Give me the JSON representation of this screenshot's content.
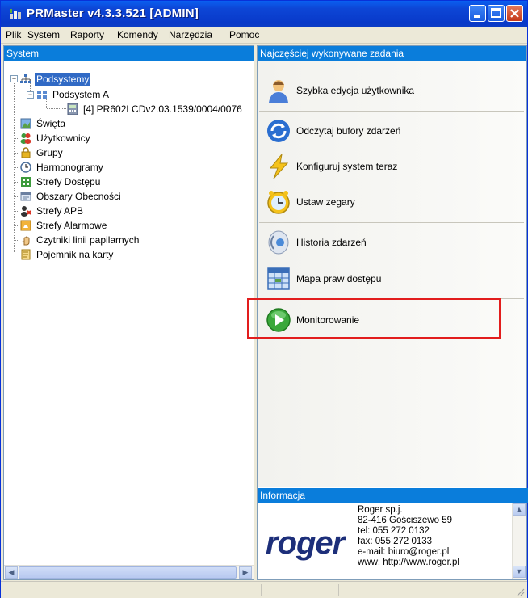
{
  "window": {
    "title": "PRMaster v4.3.3.521 [ADMIN]"
  },
  "menu": [
    "Plik",
    "System",
    "Raporty",
    "Komendy",
    "Narzędzia",
    "Pomoc"
  ],
  "left_panel": {
    "header": "System",
    "tree": [
      {
        "label": "Podsystemy",
        "icon": "network-icon",
        "selected": true
      },
      {
        "label": "Podsystem A",
        "icon": "subsystem-icon"
      },
      {
        "label": "[4] PR602LCDv2.03.1539/0004/0076",
        "icon": "device-icon"
      },
      {
        "label": "Święta",
        "icon": "holiday-icon"
      },
      {
        "label": "Użytkownicy",
        "icon": "users-icon"
      },
      {
        "label": "Grupy",
        "icon": "groups-icon"
      },
      {
        "label": "Harmonogramy",
        "icon": "schedule-icon"
      },
      {
        "label": "Strefy Dostępu",
        "icon": "access-zone-icon"
      },
      {
        "label": "Obszary Obecności",
        "icon": "attendance-area-icon"
      },
      {
        "label": "Strefy APB",
        "icon": "apb-zone-icon"
      },
      {
        "label": "Strefy Alarmowe",
        "icon": "alarm-zone-icon"
      },
      {
        "label": "Czytniki linii papilarnych",
        "icon": "fingerprint-icon"
      },
      {
        "label": "Pojemnik na karty",
        "icon": "card-container-icon"
      }
    ]
  },
  "right_panel": {
    "header": "Najczęściej wykonywane zadania",
    "tasks": [
      {
        "label": "Szybka edycja użytkownika",
        "icon": "user-edit-icon"
      },
      {
        "label": "Odczytaj bufory zdarzeń",
        "icon": "read-buffer-icon"
      },
      {
        "label": "Konfiguruj system teraz",
        "icon": "configure-icon"
      },
      {
        "label": "Ustaw zegary",
        "icon": "clock-icon"
      },
      {
        "label": "Historia zdarzeń",
        "icon": "history-icon"
      },
      {
        "label": "Mapa praw dostępu",
        "icon": "access-map-icon"
      },
      {
        "label": "Monitorowanie",
        "icon": "monitoring-icon"
      }
    ]
  },
  "info": {
    "header": "Informacja",
    "logo": "roger",
    "lines": [
      "Roger sp.j.",
      "82-416 Gościszewo 59",
      "tel: 055 272 0132",
      "fax: 055 272 0133",
      "e-mail: biuro@roger.pl",
      "www: http://www.roger.pl"
    ]
  },
  "colors": {
    "accent": "#0a7ddb",
    "highlight": "#e21d1d",
    "titlebar": "#0839c9"
  }
}
